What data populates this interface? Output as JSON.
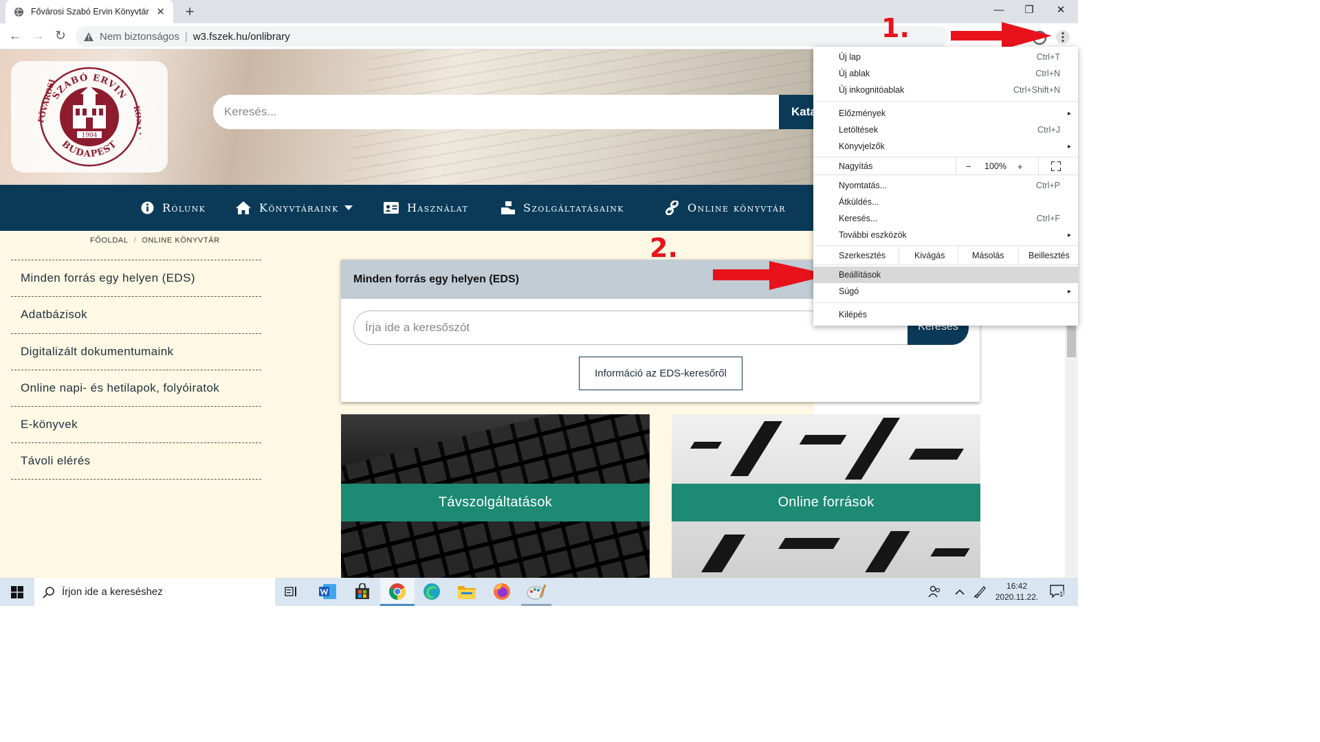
{
  "browser": {
    "tab_title": "Fővárosi Szabó Ervin Könyvtár",
    "tab_close": "✕",
    "new_tab": "+",
    "window_controls": {
      "minimize": "—",
      "restore": "❐",
      "close": "✕"
    },
    "nav": {
      "back": "←",
      "forward": "→",
      "reload": "↻"
    },
    "security_label": "Nem biztonságos",
    "separator": "|",
    "url": "w3.fszek.hu/onlibrary"
  },
  "site": {
    "logo": {
      "ring_top": "SZABÓ ERVIN",
      "ring_left": "FŐVÁROSI",
      "ring_right": "KÖNYVTÁR",
      "ring_bottom": "BUDAPEST",
      "year": "1904"
    },
    "search_placeholder": "Keresés...",
    "catalog_button": "Katalógus",
    "nav": [
      {
        "label": "Rólunk",
        "icon": "info-circle-icon"
      },
      {
        "label": "Könyvtáraink",
        "icon": "home-icon"
      },
      {
        "label": "Használat",
        "icon": "id-card-icon"
      },
      {
        "label": "Szolgáltatásaink",
        "icon": "hand-box-icon"
      },
      {
        "label": "Online könyvtár",
        "icon": "link-icon"
      }
    ],
    "breadcrumb": [
      "Főoldal",
      "Online könyvtár"
    ],
    "breadcrumb_sep": "/",
    "sidebar": [
      "Minden forrás egy helyen (EDS)",
      "Adatbázisok",
      "Digitalizált dokumentumaink",
      "Online napi- és hetilapok, folyóiratok",
      "E-könyvek",
      "Távoli elérés"
    ],
    "eds": {
      "title": "Minden forrás egy helyen (EDS)",
      "input_placeholder": "Írja ide a keresőszót",
      "search_button": "Keresés",
      "info_button": "Információ az EDS-keresőről"
    },
    "tiles": [
      "Távszolgáltatások",
      "Online források"
    ]
  },
  "annotations": {
    "step1": "1.",
    "step2": "2."
  },
  "menu": {
    "items": [
      {
        "label": "Új lap",
        "shortcut": "Ctrl+T"
      },
      {
        "label": "Új ablak",
        "shortcut": "Ctrl+N"
      },
      {
        "label": "Új inkognitóablak",
        "shortcut": "Ctrl+Shift+N"
      },
      {
        "label": "Előzmények",
        "submenu": "▸"
      },
      {
        "label": "Letöltések",
        "shortcut": "Ctrl+J"
      },
      {
        "label": "Könyvjelzők",
        "submenu": "▸"
      },
      {
        "label": "Nyomtatás...",
        "shortcut": "Ctrl+P"
      },
      {
        "label": "Átküldés..."
      },
      {
        "label": "Keresés...",
        "shortcut": "Ctrl+F"
      },
      {
        "label": "További eszközök",
        "submenu": "▸"
      },
      {
        "label": "Beállítások"
      },
      {
        "label": "Súgó",
        "submenu": "▸"
      },
      {
        "label": "Kilépés"
      }
    ],
    "zoom": {
      "label": "Nagyítás",
      "minus": "−",
      "value": "100%",
      "plus": "+"
    },
    "edit": {
      "label": "Szerkesztés",
      "cut": "Kivágás",
      "copy": "Másolás",
      "paste": "Beillesztés"
    }
  },
  "taskbar": {
    "search_placeholder": "Írjon ide a kereséshez",
    "time": "16:42",
    "date": "2020.11.22.",
    "notification_count": "1"
  },
  "colors": {
    "nav_bg": "#0a3a58",
    "page_bg": "#fff8e4",
    "teal": "#1d8a73",
    "annotation_red": "#e8121c",
    "logo_red": "#8c1c2e"
  }
}
